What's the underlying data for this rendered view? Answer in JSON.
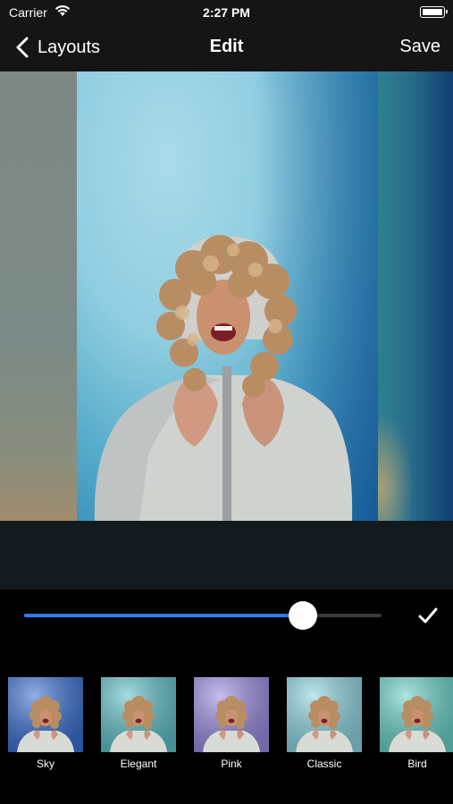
{
  "status_bar": {
    "carrier": "Carrier",
    "time": "2:27 PM"
  },
  "nav": {
    "back_label": "Layouts",
    "title": "Edit",
    "save_label": "Save"
  },
  "icons": {
    "back": "chevron-left-icon",
    "confirm": "checkmark-icon",
    "wifi": "wifi-icon",
    "battery": "battery-icon"
  },
  "slider": {
    "value": 0.78,
    "fill_color": "#2f7cf6"
  },
  "filters": [
    {
      "label": "Sky",
      "tint": "#3a6fd0"
    },
    {
      "label": "Elegant",
      "tint": "#5fc0c8"
    },
    {
      "label": "Pink",
      "tint": "#9a8ae0"
    },
    {
      "label": "Classic",
      "tint": "#8cd4e0"
    },
    {
      "label": "Bird",
      "tint": "#6ad0c8"
    }
  ]
}
